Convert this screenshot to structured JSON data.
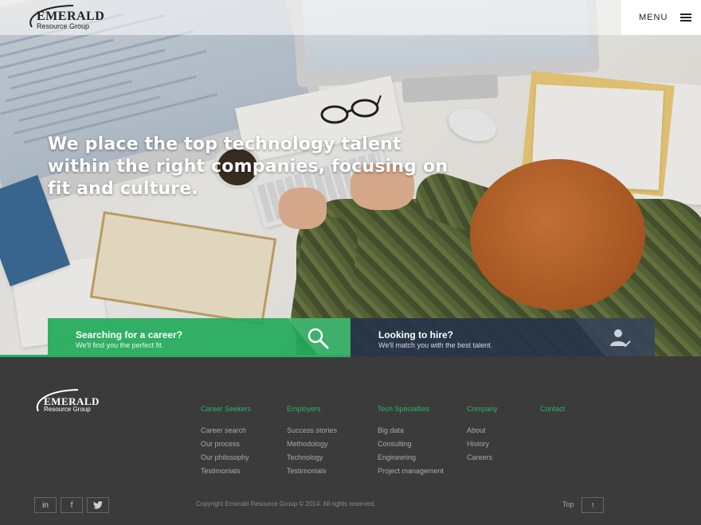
{
  "header": {
    "logo": {
      "word": "EMERALD",
      "sub": "Resource Group",
      "tm": "TM"
    },
    "menu_label": "MENU",
    "menu_icon": "hamburger-icon"
  },
  "hero": {
    "headline": "We place the top technology talent within the right companies, focusing on fit and culture."
  },
  "cta": {
    "seekers": {
      "title": "Searching for a career?",
      "subtitle": "We'll find you the perfect fit.",
      "icon": "magnifier-icon",
      "color": "#22aa5a"
    },
    "employers": {
      "title": "Looking to hire?",
      "subtitle": "We'll match you with the best talent.",
      "icon": "person-check-icon",
      "color": "#263448"
    }
  },
  "footer": {
    "logo": {
      "word": "EMERALD",
      "sub": "Resource Group"
    },
    "columns": [
      {
        "title": "Career Seekers",
        "links": [
          "Career search",
          "Our process",
          "Our philosophy",
          "Testimonials"
        ]
      },
      {
        "title": "Employers",
        "links": [
          "Success stories",
          "Methodology",
          "Technology",
          "Testimonials"
        ]
      },
      {
        "title": "Tech Specialties",
        "links": [
          "Big data",
          "Consulting",
          "Engineering",
          "Project management"
        ]
      },
      {
        "title": "Company",
        "links": [
          "About",
          "History",
          "Careers"
        ]
      },
      {
        "title": "Contact",
        "links": []
      }
    ],
    "social": [
      {
        "label": "in",
        "icon": "linkedin-icon"
      },
      {
        "label": "f",
        "icon": "facebook-icon"
      },
      {
        "label": "🐦",
        "icon": "twitter-icon"
      }
    ],
    "copyright": "Copyright Emerald Resource Group © 2014. All rights reserved.",
    "top_label": "Top",
    "top_arrow": "↑",
    "accent": "#2cb566"
  }
}
